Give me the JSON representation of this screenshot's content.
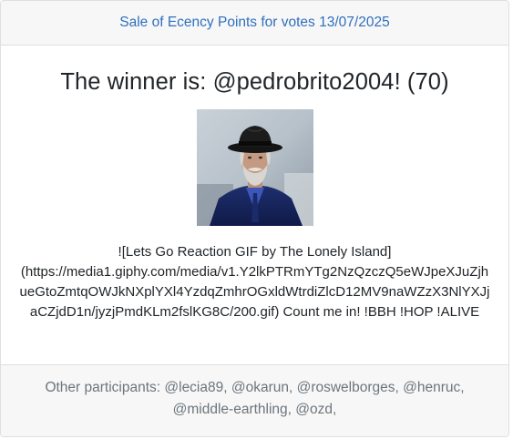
{
  "header": {
    "link_text": "Sale of Ecency Points for votes 13/07/2025"
  },
  "winner": {
    "title": "The winner is: @pedrobrito2004! (70)"
  },
  "comment": {
    "text": "![Lets Go Reaction GIF by The Lonely Island](https://media1.giphy.com/media/v1.Y2lkPTRmYTg2NzQzczQ5eWJpeXJuZjhueGtoZmtqOWJkNXplYXl4YzdqZmhrOGxldWtrdiZlcD12MV9naWZzX3NlYXJjaCZjdD1n/jyzjPmdKLm2fslKG8C/200.gif) Count me in! !BBH !HOP !ALIVE"
  },
  "footer": {
    "participants_text": "Other participants: @lecia89, @okarun, @roswelborges, @henruc, @middle-earthling, @ozd,"
  },
  "colors": {
    "link": "#2f6fbf",
    "muted": "#6c757d",
    "header_bg": "#f7f7f7",
    "border": "#dfdfdf"
  }
}
